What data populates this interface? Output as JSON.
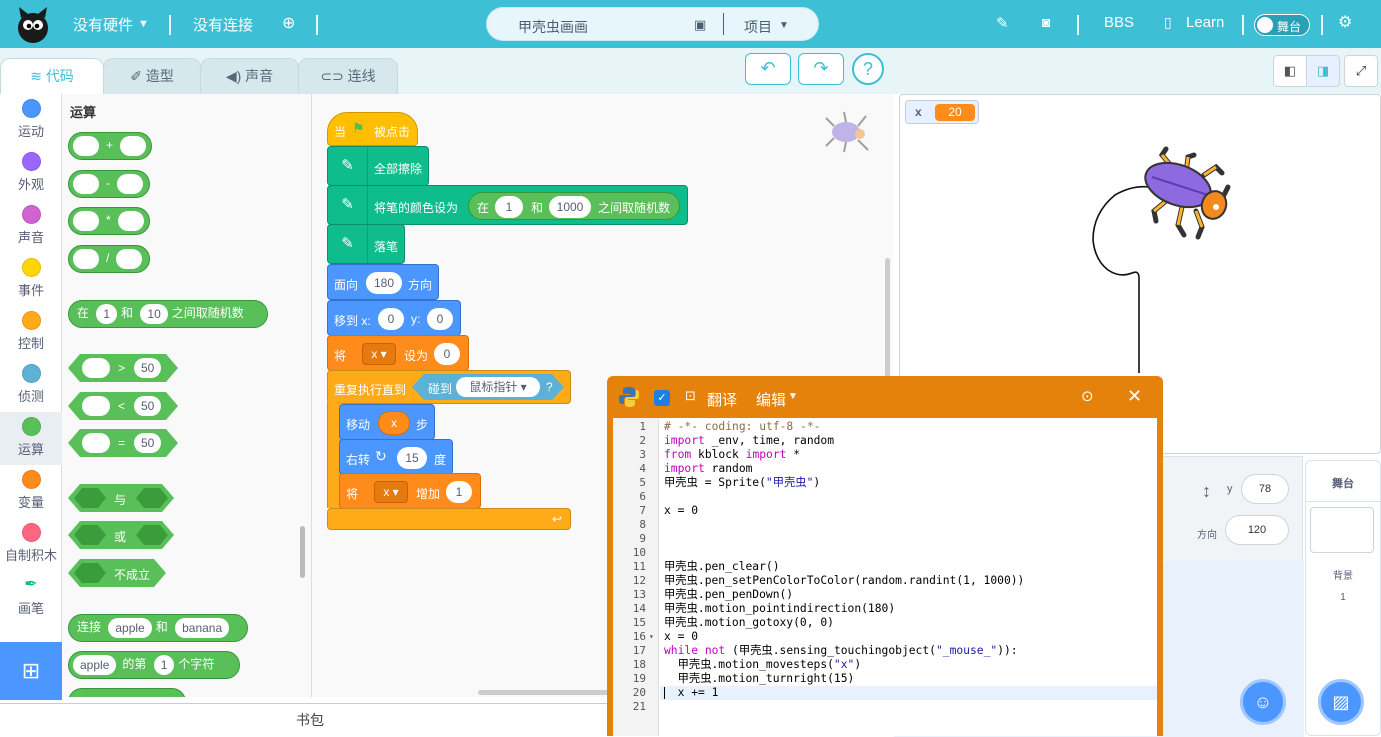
{
  "topbar": {
    "hardware": "没有硬件",
    "connection": "没有连接",
    "project_title": "甲壳虫画画",
    "project_menu": "项目",
    "bbs": "BBS",
    "learn": "Learn",
    "stage_toggle": "舞台"
  },
  "tabs": {
    "code": "代码",
    "costume": "造型",
    "sound": "声音",
    "wire": "连线"
  },
  "categories": [
    {
      "label": "运动",
      "color": "#4c97ff"
    },
    {
      "label": "外观",
      "color": "#9966ff"
    },
    {
      "label": "声音",
      "color": "#cf63cf"
    },
    {
      "label": "事件",
      "color": "#ffd500"
    },
    {
      "label": "控制",
      "color": "#ffab19"
    },
    {
      "label": "侦测",
      "color": "#5cb1d6"
    },
    {
      "label": "运算",
      "color": "#59c059"
    },
    {
      "label": "变量",
      "color": "#ff8c1a"
    },
    {
      "label": "自制积木",
      "color": "#ff6680"
    },
    {
      "label": "画笔",
      "color": "#0fbd8c"
    }
  ],
  "palette": {
    "title": "运算",
    "plus": "+",
    "minus": "-",
    "times": "*",
    "divide": "/",
    "rand_in": "在",
    "rand_a": "1",
    "rand_and": "和",
    "rand_b": "10",
    "rand_tail": "之间取随机数",
    "gt_val": "50",
    "lt_val": "50",
    "eq_val": "50",
    "gt": ">",
    "lt": "<",
    "eq": "=",
    "and_op": "与",
    "or_op": "或",
    "not_op": "不成立",
    "join_label": "连接",
    "join_a": "apple",
    "join_and": "和",
    "join_b": "banana",
    "letter_a": "apple",
    "letter_of": "的第",
    "letter_n": "1",
    "letter_tail": "个字符"
  },
  "script": {
    "hat_when": "当",
    "hat_clicked": "被点击",
    "clear": "全部擦除",
    "setcolor": "将笔的颜色设为",
    "rand_in": "在",
    "rand_a": "1",
    "rand_and": "和",
    "rand_b": "1000",
    "rand_tail": "之间取随机数",
    "pendown": "落笔",
    "point": "面向",
    "point_val": "180",
    "point_tail": "方向",
    "goto": "移到 x:",
    "goto_x": "0",
    "goto_y_label": "y:",
    "goto_y": "0",
    "set_var": "将",
    "var_name": "x",
    "set_to": "设为",
    "set_val": "0",
    "repeat": "重复执行直到",
    "touching": "碰到",
    "mouse": "鼠标指针",
    "q": "?",
    "move": "移动",
    "move_val": "x",
    "steps": "步",
    "turn": "右转",
    "turn_val": "15",
    "deg": "度",
    "change_var": "将",
    "change_name": "x",
    "change_by": "增加",
    "change_val": "1"
  },
  "stage": {
    "var_label": "x",
    "var_value": "20"
  },
  "sprite_info": {
    "y_label": "y",
    "y_value": "78",
    "dir_label": "方向",
    "dir_value": "120"
  },
  "stage_panel": {
    "title": "舞台",
    "backdrop_label": "背景",
    "backdrop_count": "1"
  },
  "bag": "书包",
  "editor": {
    "translate": "翻译",
    "edit": "编辑",
    "lines": [
      "# -*- coding: utf-8 -*-",
      "import _env, time, random",
      "from kblock import *",
      "import random",
      "甲壳虫 = Sprite(\"甲壳虫\")",
      "",
      "x = 0",
      "",
      "",
      "",
      "甲壳虫.pen_clear()",
      "甲壳虫.pen_setPenColorToColor(random.randint(1, 1000))",
      "甲壳虫.pen_penDown()",
      "甲壳虫.motion_pointindirection(180)",
      "甲壳虫.motion_gotoxy(0, 0)",
      "x = 0",
      "while not (甲壳虫.sensing_touchingobject(\"_mouse_\")):",
      "  甲壳虫.motion_movesteps(\"x\")",
      "  甲壳虫.motion_turnright(15)",
      "  x += 1",
      ""
    ]
  }
}
